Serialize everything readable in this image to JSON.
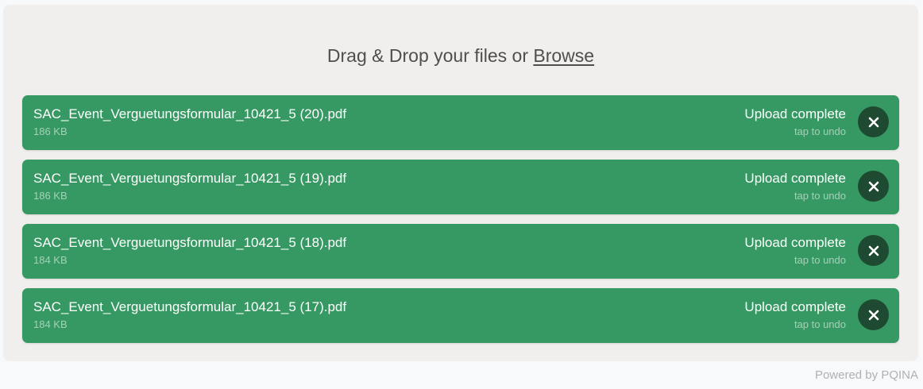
{
  "dropzone": {
    "prefix": "Drag & Drop your files or ",
    "browse_label": "Browse"
  },
  "files": [
    {
      "name": "SAC_Event_Verguetungsformular_10421_5 (20).pdf",
      "size": "186 KB",
      "status": "Upload complete",
      "substatus": "tap to undo"
    },
    {
      "name": "SAC_Event_Verguetungsformular_10421_5 (19).pdf",
      "size": "186 KB",
      "status": "Upload complete",
      "substatus": "tap to undo"
    },
    {
      "name": "SAC_Event_Verguetungsformular_10421_5 (18).pdf",
      "size": "184 KB",
      "status": "Upload complete",
      "substatus": "tap to undo"
    },
    {
      "name": "SAC_Event_Verguetungsformular_10421_5 (17).pdf",
      "size": "184 KB",
      "status": "Upload complete",
      "substatus": "tap to undo"
    }
  ],
  "remove_icon": "close-icon",
  "credits": "Powered by PQINA",
  "colors": {
    "item_bg": "#369862",
    "remove_btn_bg": "#1d4a30",
    "panel_bg": "#f1efee"
  }
}
